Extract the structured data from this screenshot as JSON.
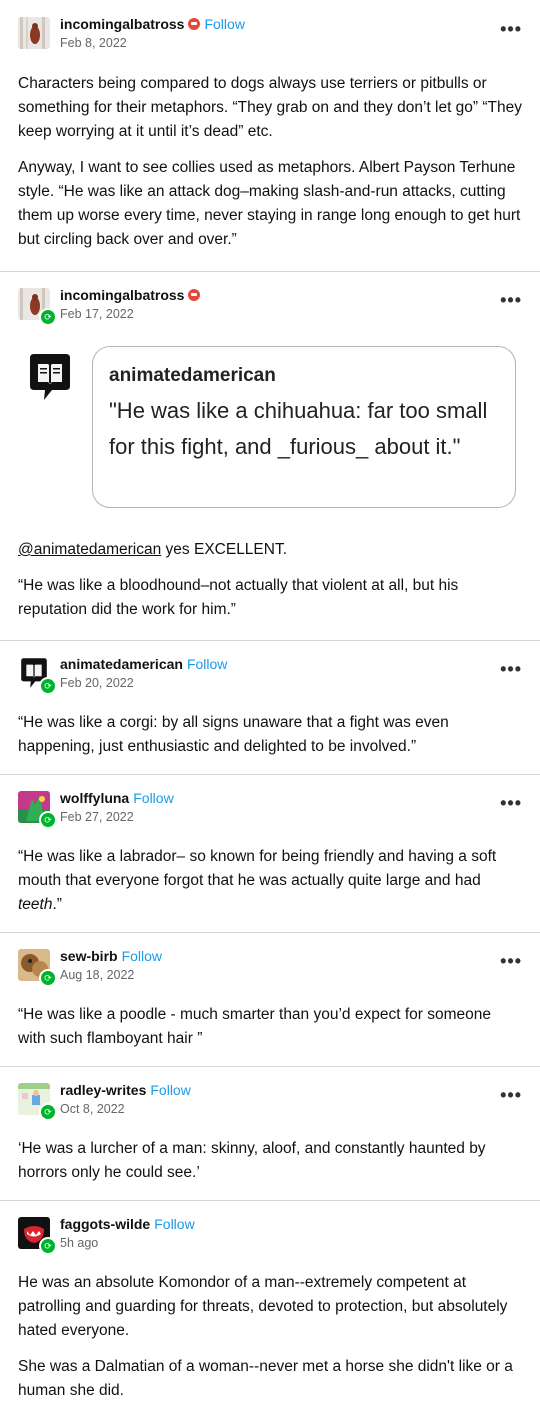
{
  "posts": [
    {
      "username": "incomingalbatross",
      "follow": "Follow",
      "date": "Feb 8, 2022",
      "more": "•••",
      "paragraphs": [
        "Characters being compared to dogs always use terriers or pitbulls or something for their metaphors. “They grab on and they don’t let go” “They keep worrying at it until it’s dead” etc.",
        "Anyway, I want to see collies used as metaphors. Albert Payson Terhune style. “He was like an attack dog–making slash-and-run attacks, cutting them up worse every time, never staying in range long enough to get hurt but circling back over and over.”"
      ]
    },
    {
      "username": "incomingalbatross",
      "date": "Feb 17, 2022",
      "more": "•••",
      "quote": {
        "username": "animatedamerican",
        "text": "\"He was like a chihuahua: far too small for this fight, and _furious_ about it.\""
      },
      "mention": "@animatedamerican",
      "mention_rest": " yes EXCELLENT.",
      "paragraph2": "“He was like a bloodhound–not actually that violent at all, but his reputation did the work for him.”"
    },
    {
      "username": "animatedamerican",
      "follow": "Follow",
      "date": "Feb 20, 2022",
      "more": "•••",
      "text": "“He was like a corgi: by all signs unaware that a fight was even happening, just enthusiastic and delighted to be involved.”"
    },
    {
      "username": "wolffyluna",
      "follow": "Follow",
      "date": "Feb 27, 2022",
      "more": "•••",
      "text_main": "“He was like a labrador– so known for being friendly and having a soft mouth that everyone forgot that he was actually quite large and had ",
      "text_em": "teeth",
      "text_end": ".”"
    },
    {
      "username": "sew-birb",
      "follow": "Follow",
      "date": "Aug 18, 2022",
      "more": "•••",
      "text": "“He was like a poodle - much smarter than you’d expect for someone with such flamboyant hair ”"
    },
    {
      "username": "radley-writes",
      "follow": "Follow",
      "date": "Oct 8, 2022",
      "more": "•••",
      "text": "‘He was a lurcher of a man: skinny, aloof, and constantly haunted by horrors only he could see.’"
    },
    {
      "username": "faggots-wilde",
      "follow": "Follow",
      "date": "5h ago",
      "paragraphs": [
        "He was an absolute Komondor of a man--extremely competent at patrolling and guarding for threats, devoted to protection, but absolutely hated everyone.",
        "She was a Dalmatian of a woman--never met a horse she didn't like or a human she did."
      ]
    }
  ],
  "colors": {
    "follow": "#1a9be6",
    "reblog_badge": "#00b32c",
    "verified": "#e8483c"
  },
  "icons": {
    "more": "more-options-icon",
    "reblog": "reblog-icon",
    "verified": "verified-badge-icon"
  }
}
